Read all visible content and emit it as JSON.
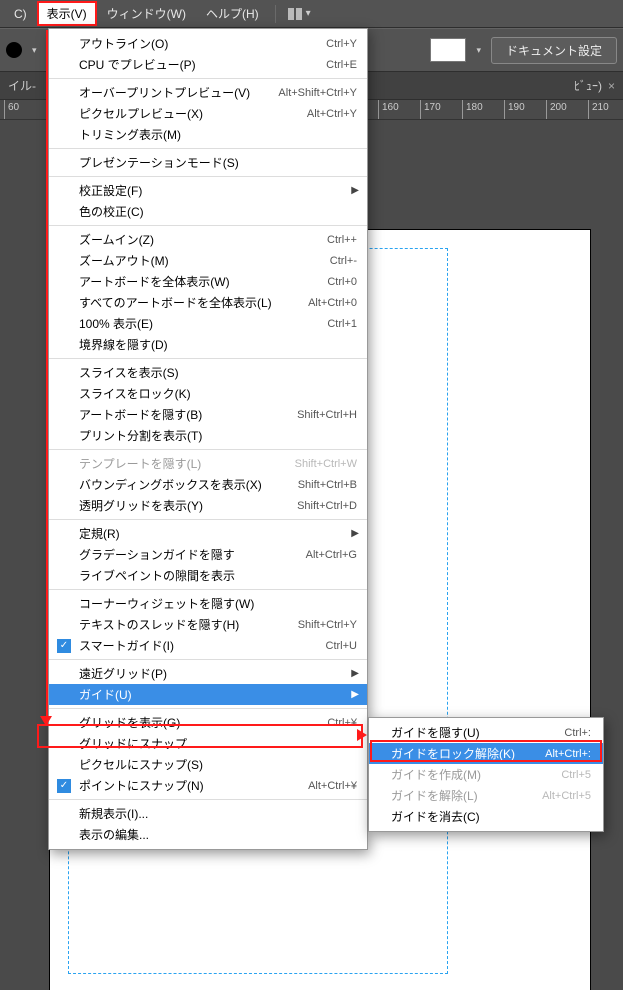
{
  "menubar": {
    "items": [
      {
        "label": "C)"
      },
      {
        "label": "表示(V)"
      },
      {
        "label": "ウィンドウ(W)"
      },
      {
        "label": "ヘルプ(H)"
      }
    ]
  },
  "toolbar": {
    "doc_setup": "ドキュメント設定"
  },
  "tab": {
    "name_left": "イル-",
    "name_right": "ﾋﾞｭｰ)",
    "close": "×"
  },
  "ruler_ticks": [
    "60",
    "160",
    "170",
    "180",
    "190",
    "200",
    "210"
  ],
  "view_menu": [
    {
      "type": "item",
      "label": "アウトライン(O)",
      "shortcut": "Ctrl+Y"
    },
    {
      "type": "item",
      "label": "CPU でプレビュー(P)",
      "shortcut": "Ctrl+E"
    },
    {
      "type": "sep"
    },
    {
      "type": "item",
      "label": "オーバープリントプレビュー(V)",
      "shortcut": "Alt+Shift+Ctrl+Y"
    },
    {
      "type": "item",
      "label": "ピクセルプレビュー(X)",
      "shortcut": "Alt+Ctrl+Y"
    },
    {
      "type": "item",
      "label": "トリミング表示(M)",
      "shortcut": ""
    },
    {
      "type": "sep"
    },
    {
      "type": "item",
      "label": "プレゼンテーションモード(S)",
      "shortcut": ""
    },
    {
      "type": "sep"
    },
    {
      "type": "item",
      "label": "校正設定(F)",
      "shortcut": "",
      "submenu": true
    },
    {
      "type": "item",
      "label": "色の校正(C)",
      "shortcut": ""
    },
    {
      "type": "sep"
    },
    {
      "type": "item",
      "label": "ズームイン(Z)",
      "shortcut": "Ctrl++"
    },
    {
      "type": "item",
      "label": "ズームアウト(M)",
      "shortcut": "Ctrl+-"
    },
    {
      "type": "item",
      "label": "アートボードを全体表示(W)",
      "shortcut": "Ctrl+0"
    },
    {
      "type": "item",
      "label": "すべてのアートボードを全体表示(L)",
      "shortcut": "Alt+Ctrl+0"
    },
    {
      "type": "item",
      "label": "100% 表示(E)",
      "shortcut": "Ctrl+1"
    },
    {
      "type": "item",
      "label": "境界線を隠す(D)",
      "shortcut": ""
    },
    {
      "type": "sep"
    },
    {
      "type": "item",
      "label": "スライスを表示(S)",
      "shortcut": ""
    },
    {
      "type": "item",
      "label": "スライスをロック(K)",
      "shortcut": ""
    },
    {
      "type": "item",
      "label": "アートボードを隠す(B)",
      "shortcut": "Shift+Ctrl+H"
    },
    {
      "type": "item",
      "label": "プリント分割を表示(T)",
      "shortcut": ""
    },
    {
      "type": "sep"
    },
    {
      "type": "item",
      "label": "テンプレートを隠す(L)",
      "shortcut": "Shift+Ctrl+W",
      "disabled": true
    },
    {
      "type": "item",
      "label": "バウンディングボックスを表示(X)",
      "shortcut": "Shift+Ctrl+B"
    },
    {
      "type": "item",
      "label": "透明グリッドを表示(Y)",
      "shortcut": "Shift+Ctrl+D"
    },
    {
      "type": "sep"
    },
    {
      "type": "item",
      "label": "定規(R)",
      "shortcut": "",
      "submenu": true
    },
    {
      "type": "item",
      "label": "グラデーションガイドを隠す",
      "shortcut": "Alt+Ctrl+G"
    },
    {
      "type": "item",
      "label": "ライブペイントの隙間を表示",
      "shortcut": ""
    },
    {
      "type": "sep"
    },
    {
      "type": "item",
      "label": "コーナーウィジェットを隠す(W)",
      "shortcut": ""
    },
    {
      "type": "item",
      "label": "テキストのスレッドを隠す(H)",
      "shortcut": "Shift+Ctrl+Y"
    },
    {
      "type": "item",
      "label": "スマートガイド(I)",
      "shortcut": "Ctrl+U",
      "checked": true
    },
    {
      "type": "sep"
    },
    {
      "type": "item",
      "label": "遠近グリッド(P)",
      "shortcut": "",
      "submenu": true
    },
    {
      "type": "item",
      "label": "ガイド(U)",
      "shortcut": "",
      "submenu": true,
      "hover": true
    },
    {
      "type": "sep"
    },
    {
      "type": "item",
      "label": "グリッドを表示(G)",
      "shortcut": "Ctrl+¥"
    },
    {
      "type": "item",
      "label": "グリッドにスナップ",
      "shortcut": ""
    },
    {
      "type": "item",
      "label": "ピクセルにスナップ(S)",
      "shortcut": ""
    },
    {
      "type": "item",
      "label": "ポイントにスナップ(N)",
      "shortcut": "Alt+Ctrl+¥",
      "checked": true
    },
    {
      "type": "sep"
    },
    {
      "type": "item",
      "label": "新規表示(I)...",
      "shortcut": ""
    },
    {
      "type": "item",
      "label": "表示の編集...",
      "shortcut": ""
    }
  ],
  "guide_submenu": [
    {
      "label": "ガイドを隠す(U)",
      "shortcut": "Ctrl+:"
    },
    {
      "label": "ガイドをロック解除(K)",
      "shortcut": "Alt+Ctrl+:",
      "hover": true
    },
    {
      "label": "ガイドを作成(M)",
      "shortcut": "Ctrl+5",
      "disabled": true
    },
    {
      "label": "ガイドを解除(L)",
      "shortcut": "Alt+Ctrl+5",
      "disabled": true
    },
    {
      "label": "ガイドを消去(C)",
      "shortcut": ""
    }
  ]
}
